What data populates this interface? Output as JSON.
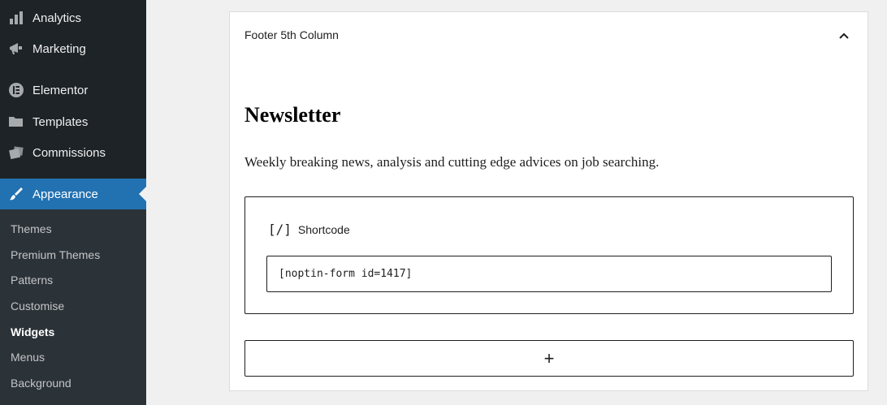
{
  "sidebar": {
    "items": [
      {
        "label": "Analytics",
        "icon": "bar-chart-icon"
      },
      {
        "label": "Marketing",
        "icon": "megaphone-icon"
      },
      {
        "label": "Elementor",
        "icon": "elementor-icon"
      },
      {
        "label": "Templates",
        "icon": "folder-icon"
      },
      {
        "label": "Commissions",
        "icon": "tickets-icon"
      },
      {
        "label": "Appearance",
        "icon": "paintbrush-icon",
        "active": true
      }
    ],
    "submenu": [
      {
        "label": "Themes"
      },
      {
        "label": "Premium Themes"
      },
      {
        "label": "Patterns"
      },
      {
        "label": "Customise"
      },
      {
        "label": "Widgets",
        "current": true
      },
      {
        "label": "Menus"
      },
      {
        "label": "Background"
      }
    ]
  },
  "panel": {
    "title": "Footer 5th Column",
    "heading": "Newsletter",
    "paragraph": "Weekly breaking news, analysis and cutting edge advices on job searching.",
    "shortcode": {
      "icon_text": "[/]",
      "label": "Shortcode",
      "value": "[noptin-form id=1417]"
    },
    "add_block_symbol": "+"
  },
  "colors": {
    "sidebar_bg": "#1d2327",
    "submenu_bg": "#2c3338",
    "accent": "#2271b1"
  }
}
